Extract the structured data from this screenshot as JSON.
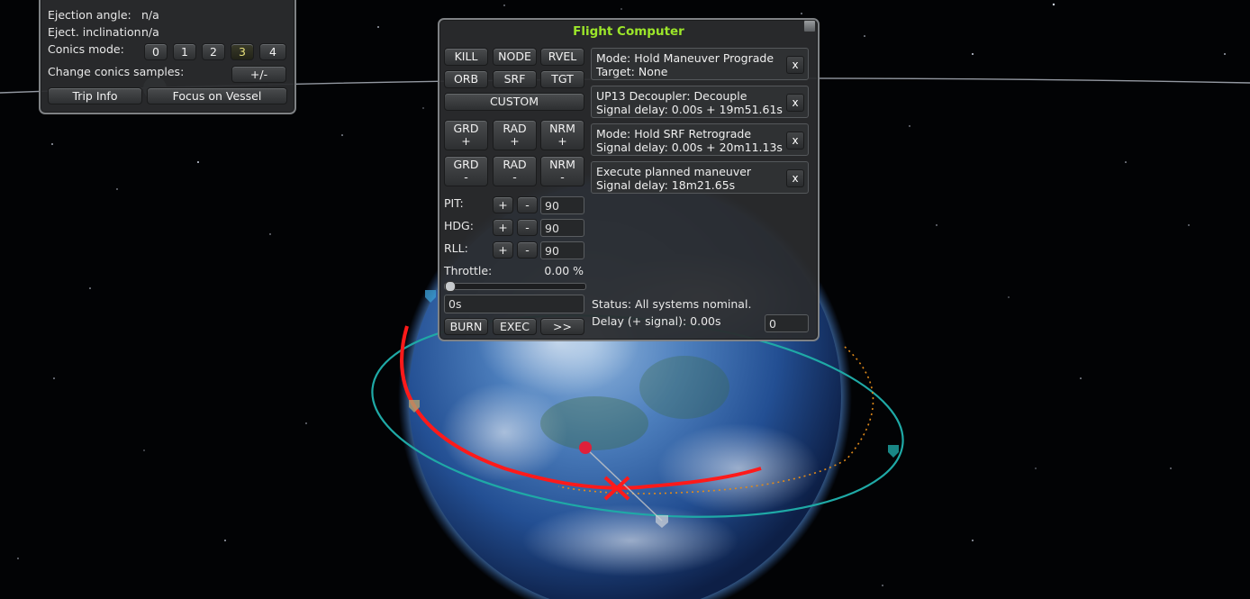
{
  "info_panel": {
    "ejection_angle_label": "Ejection angle:",
    "ejection_angle_value": "n/a",
    "eject_inclination_label": "Eject. inclination:",
    "eject_inclination_value": "n/a",
    "conics_mode_label": "Conics mode:",
    "conics_modes": [
      "0",
      "1",
      "2",
      "3",
      "4"
    ],
    "conics_mode_selected": "3",
    "change_samples_label": "Change conics samples:",
    "change_samples_button": "+/-",
    "trip_info_button": "Trip Info",
    "focus_vessel_button": "Focus on Vessel"
  },
  "flight_computer": {
    "title": "Flight Computer",
    "mode_buttons": {
      "kill": "KILL",
      "node": "NODE",
      "rvel": "RVEL",
      "orb": "ORB",
      "srf": "SRF",
      "tgt": "TGT",
      "custom": "CUSTOM"
    },
    "direction_buttons": {
      "grd_plus": {
        "top": "GRD",
        "bottom": "+"
      },
      "rad_plus": {
        "top": "RAD",
        "bottom": "+"
      },
      "nrm_plus": {
        "top": "NRM",
        "bottom": "+"
      },
      "grd_minus": {
        "top": "GRD",
        "bottom": "-"
      },
      "rad_minus": {
        "top": "RAD",
        "bottom": "-"
      },
      "nrm_minus": {
        "top": "NRM",
        "bottom": "-"
      }
    },
    "attitude": {
      "pit_label": "PIT:",
      "pit_value": "90",
      "hdg_label": "HDG:",
      "hdg_value": "90",
      "rll_label": "RLL:",
      "rll_value": "90",
      "plus": "+",
      "minus": "-"
    },
    "throttle_label": "Throttle:",
    "throttle_value": "0.00 %",
    "throttle_fraction": 0.0,
    "duration_value": "0s",
    "burn_button": "BURN",
    "exec_button": "EXEC",
    "more_button": ">>",
    "queue": [
      {
        "line1": "Mode: Hold Maneuver Prograde",
        "line2": "Target: None",
        "remove": "x"
      },
      {
        "line1": "UP13 Decoupler: Decouple",
        "line2": "Signal delay: 0.00s + 19m51.61s",
        "remove": "x"
      },
      {
        "line1": "Mode: Hold SRF Retrograde",
        "line2": "Signal delay: 0.00s + 20m11.13s",
        "remove": "x"
      },
      {
        "line1": "Execute planned maneuver",
        "line2": "Signal delay: 18m21.65s",
        "remove": "x"
      }
    ],
    "status_text": "Status: All systems nominal.",
    "delay_label": "Delay (+ signal): 0.00s",
    "delay_input": "0"
  },
  "colors": {
    "title_green": "#9ce62a",
    "orbit_teal": "#1fa9a6",
    "trajectory_red": "#ff1a1a",
    "planet_blue": "#2e5fa8"
  }
}
